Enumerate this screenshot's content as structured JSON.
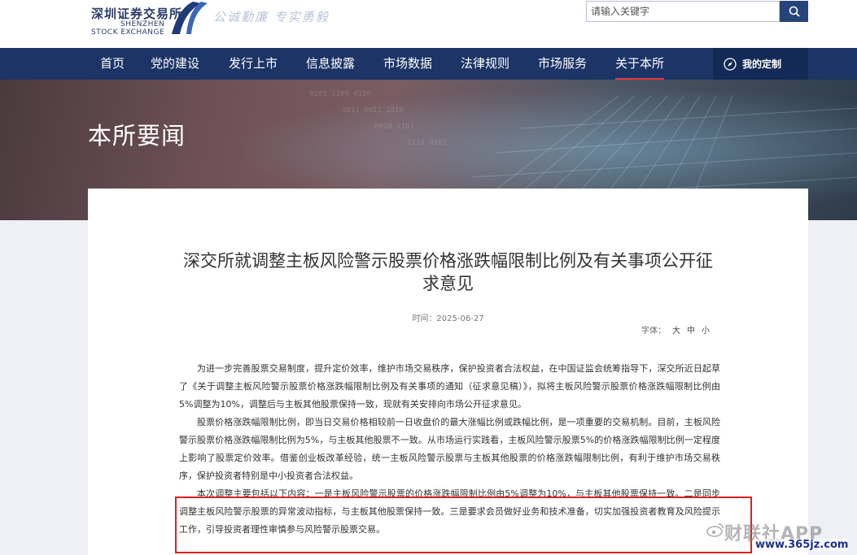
{
  "header": {
    "logo_cn": "深圳证券交易所",
    "logo_en_1": "SHENZHEN",
    "logo_en_2": "STOCK EXCHANGE",
    "slogan": "公诚勤廉 专实勇毅",
    "search_placeholder": "请输入关键字",
    "search_icon": "search-icon"
  },
  "nav": {
    "items": [
      "首页",
      "党的建设",
      "发行上市",
      "信息披露",
      "市场数据",
      "法律规则",
      "市场服务",
      "关于本所"
    ],
    "active_index": 7,
    "custom_label": "我的定制",
    "custom_icon": "compass-icon"
  },
  "banner": {
    "title": "本所要闻"
  },
  "article": {
    "title": "深交所就调整主板风险警示股票价格涨跌幅限制比例及有关事项公开征求意见",
    "date": "时间：2025-06-27",
    "font_label": "字体：",
    "font_sizes": [
      "大",
      "中",
      "小"
    ],
    "paragraphs": [
      "为进一步完善股票交易制度，提升定价效率，维护市场交易秩序，保护投资者合法权益，在中国证监会统筹指导下，深交所近日起草了《关于调整主板风险警示股票价格涨跌幅限制比例及有关事项的通知（征求意见稿）》，拟将主板风险警示股票价格涨跌幅限制比例由5%调整为10%，调整后与主板其他股票保持一致，现就有关安排向市场公开征求意见。",
      "股票价格涨跌幅限制比例，即当日交易价格相较前一日收盘价的最大涨幅比例或跌幅比例，是一项重要的交易机制。目前，主板风险警示股票价格涨跌幅限制比例为5%，与主板其他股票不一致。从市场运行实践看，主板风险警示股票5%的价格涨跌幅限制比例一定程度上影响了股票定价效率。借鉴创业板改革经验，统一主板风险警示股票与主板其他股票的价格涨跌幅限制比例，有利于维护市场交易秩序，保护投资者特别是中小投资者合法权益。",
      "本次调整主要包括以下内容：一是主板风险警示股票的价格涨跌幅限制比例由5%调整为10%，与主板其他股票保持一致。二是同步调整主板风险警示股票的异常波动指标，与主板其他股票保持一致。三是要求会员做好业务和技术准备，切实加强投资者教育及风险提示工作，引导投资者理性审慎参与风险警示股票交易。"
    ]
  },
  "watermark": {
    "text": "财联社APP",
    "url": "www.365jz.com"
  },
  "colors": {
    "nav_bg": "#1c3466",
    "accent_red": "#e02020",
    "brand_navy": "#27447a"
  }
}
